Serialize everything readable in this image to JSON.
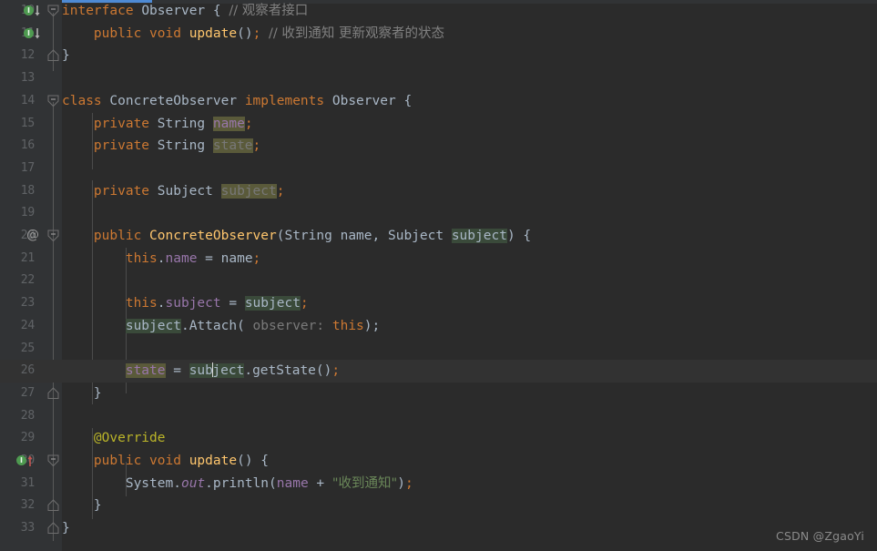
{
  "editor": {
    "theme": "darcula",
    "background": "#2b2b2b",
    "gutter_background": "#313335",
    "current_line": 26,
    "watermark": "CSDN @ZgaoYi",
    "scrollbar": {
      "name": "horizontal-scrollbar",
      "thumb_color": "#4e8ad4"
    },
    "caret": {
      "line": 26,
      "column_text": "sub|ject"
    }
  },
  "colors": {
    "keyword": "#cc7832",
    "comment": "#808080",
    "method": "#ffc66d",
    "field": "#9876aa",
    "string": "#6a8759",
    "annotation": "#bbb529",
    "identifier": "#a9b7c6",
    "line_number": "#606366",
    "highlight_write": "#5a5a3a",
    "highlight_read": "#3a4a3a",
    "accent_scrollbar": "#4e8ad4"
  },
  "lines": [
    {
      "number": "10",
      "number_visible": "0",
      "gutter": "implemented-marker-down",
      "fold": "fold-open",
      "text": "interface Observer { // 观察者接口"
    },
    {
      "number": "11",
      "number_visible": "1",
      "gutter": "implemented-marker-down",
      "fold": "none",
      "text": "    public void update(); // 收到通知 更新观察者的状态"
    },
    {
      "number": "12",
      "number_visible": "2",
      "gutter": "none",
      "fold": "fold-end",
      "text": "}"
    },
    {
      "number": "13",
      "number_visible": "3",
      "gutter": "none",
      "fold": "none",
      "text": ""
    },
    {
      "number": "14",
      "number_visible": "4",
      "gutter": "none",
      "fold": "fold-open",
      "text": "class ConcreteObserver implements Observer {"
    },
    {
      "number": "15",
      "number_visible": "5",
      "gutter": "none",
      "fold": "none",
      "text": "    private String name;"
    },
    {
      "number": "16",
      "number_visible": "6",
      "gutter": "none",
      "fold": "none",
      "text": "    private String state;"
    },
    {
      "number": "17",
      "number_visible": "7",
      "gutter": "none",
      "fold": "none",
      "text": ""
    },
    {
      "number": "18",
      "number_visible": "8",
      "gutter": "none",
      "fold": "none",
      "text": "    private Subject subject;"
    },
    {
      "number": "19",
      "number_visible": "9",
      "gutter": "none",
      "fold": "none",
      "text": ""
    },
    {
      "number": "20",
      "number_visible": "0",
      "gutter": "at-annotation",
      "fold": "fold-open",
      "text": "    public ConcreteObserver(String name, Subject subject) {"
    },
    {
      "number": "21",
      "number_visible": "1",
      "gutter": "none",
      "fold": "none",
      "text": "        this.name = name;"
    },
    {
      "number": "22",
      "number_visible": "2",
      "gutter": "none",
      "fold": "none",
      "text": ""
    },
    {
      "number": "23",
      "number_visible": "3",
      "gutter": "none",
      "fold": "none",
      "text": "        this.subject = subject;"
    },
    {
      "number": "24",
      "number_visible": "4",
      "gutter": "none",
      "fold": "none",
      "text": "        subject.Attach( observer: this);"
    },
    {
      "number": "25",
      "number_visible": "5",
      "gutter": "none",
      "fold": "none",
      "text": ""
    },
    {
      "number": "26",
      "number_visible": "6",
      "gutter": "none",
      "fold": "none",
      "text": "        state = subject.getState();"
    },
    {
      "number": "27",
      "number_visible": "7",
      "gutter": "none",
      "fold": "fold-end",
      "text": "    }"
    },
    {
      "number": "28",
      "number_visible": "8",
      "gutter": "none",
      "fold": "none",
      "text": ""
    },
    {
      "number": "29",
      "number_visible": "9",
      "gutter": "none",
      "fold": "none",
      "text": "    @Override"
    },
    {
      "number": "30",
      "number_visible": "0",
      "gutter": "implementing-marker-up",
      "fold": "fold-open",
      "text": "    public void update() {"
    },
    {
      "number": "31",
      "number_visible": "1",
      "gutter": "none",
      "fold": "none",
      "text": "        System.out.println(name + \"收到通知\");"
    },
    {
      "number": "32",
      "number_visible": "2",
      "gutter": "none",
      "fold": "fold-end",
      "text": "    }"
    },
    {
      "number": "33",
      "number_visible": "3",
      "gutter": "none",
      "fold": "fold-end",
      "text": "}"
    }
  ],
  "tokens": {
    "kw_interface": "interface",
    "kw_class": "class",
    "kw_implements": "implements",
    "kw_public": "public",
    "kw_private": "private",
    "kw_void": "void",
    "kw_this": "this",
    "type_observer": "Observer",
    "type_string": "String",
    "type_subject": "Subject",
    "type_system": "System",
    "name_concrete_observer": "ConcreteObserver",
    "method_update": "update",
    "method_attach": "Attach",
    "method_get_state": "getState",
    "method_println": "println",
    "field_name": "name",
    "field_state": "state",
    "field_subject": "subject",
    "field_out": "out",
    "annotation_override": "@Override",
    "hint_observer": "observer:",
    "string_notified": "\"收到通知\"",
    "comment_observer_interface": "// 观察者接口",
    "comment_update_state": "// 收到通知 更新观察者的状态"
  }
}
